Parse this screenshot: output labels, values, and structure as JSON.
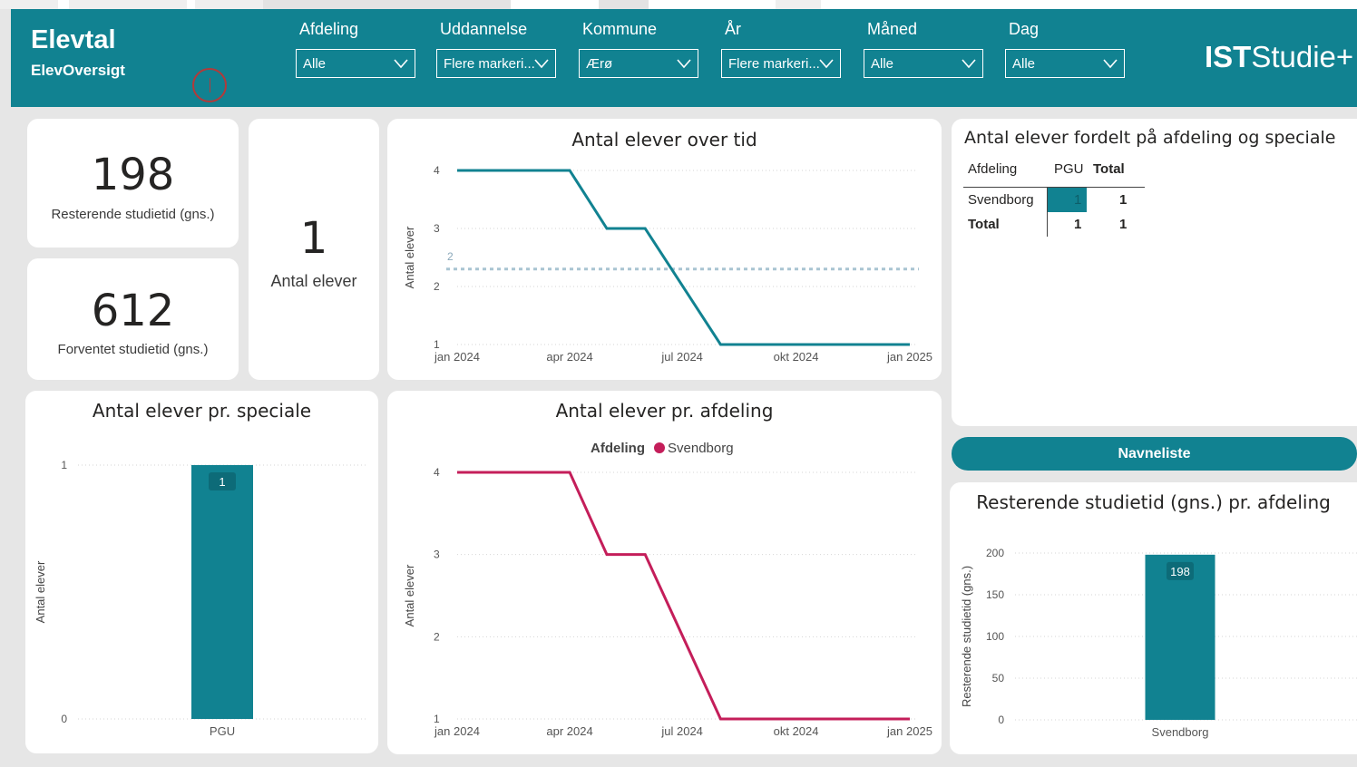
{
  "header": {
    "title": "Elevtal",
    "subtitle": "ElevOversigt",
    "logo_bold": "IST",
    "logo_light": "Studie+"
  },
  "slicers": [
    {
      "label": "Afdeling",
      "value": "Alle"
    },
    {
      "label": "Uddannelse",
      "value": "Flere markeri..."
    },
    {
      "label": "Kommune",
      "value": "Ærø"
    },
    {
      "label": "År",
      "value": "Flere markeri..."
    },
    {
      "label": "Måned",
      "value": "Alle"
    },
    {
      "label": "Dag",
      "value": "Alle"
    }
  ],
  "kpis": {
    "remaining": {
      "value": "198",
      "label": "Resterende studietid (gns.)"
    },
    "expected": {
      "value": "612",
      "label": "Forventet studietid (gns.)"
    },
    "count": {
      "value": "1",
      "label": "Antal elever"
    }
  },
  "matrix": {
    "title": "Antal elever fordelt på afdeling og speciale",
    "col_headers": [
      "Afdeling",
      "PGU",
      "Total"
    ],
    "rows": [
      {
        "label": "Svendborg",
        "pgu": "1",
        "total": "1"
      },
      {
        "label": "Total",
        "pgu": "1",
        "total": "1"
      }
    ]
  },
  "button": {
    "label": "Navneliste"
  },
  "colors": {
    "teal": "#118291",
    "crimson": "#c41e5a",
    "avg_line": "#a9c4d2"
  },
  "chart_data": [
    {
      "id": "over_time",
      "type": "line",
      "title": "Antal elever over tid",
      "xlabel": "",
      "ylabel": "Antal elever",
      "x_ticks": [
        "jan 2024",
        "apr 2024",
        "jul 2024",
        "okt 2024",
        "jan 2025"
      ],
      "x": [
        "2024-01-01",
        "2024-04-01",
        "2024-05-01",
        "2024-06-01",
        "2024-08-01",
        "2025-01-01"
      ],
      "y_ticks": [
        1,
        2,
        3,
        4
      ],
      "ylim": [
        1,
        4
      ],
      "series": [
        {
          "values": [
            4,
            4,
            3,
            3,
            1,
            1
          ],
          "color": "#118291"
        }
      ],
      "average_line": {
        "value": 2.3,
        "label": "2"
      }
    },
    {
      "id": "by_speciale",
      "type": "bar",
      "title": "Antal elever pr. speciale",
      "xlabel": "",
      "ylabel": "Antal elever",
      "categories": [
        "PGU"
      ],
      "values": [
        1
      ],
      "data_labels": [
        "1"
      ],
      "y_ticks": [
        0,
        1
      ],
      "ylim": [
        0,
        1
      ]
    },
    {
      "id": "by_afdeling",
      "type": "line",
      "title": "Antal elever pr. afdeling",
      "legend_title": "Afdeling",
      "legend_position": "top",
      "xlabel": "",
      "ylabel": "Antal elever",
      "x_ticks": [
        "jan 2024",
        "apr 2024",
        "jul 2024",
        "okt 2024",
        "jan 2025"
      ],
      "x": [
        "2024-01-01",
        "2024-04-01",
        "2024-05-01",
        "2024-06-01",
        "2024-08-01",
        "2025-01-01"
      ],
      "y_ticks": [
        1,
        2,
        3,
        4
      ],
      "ylim": [
        1,
        4
      ],
      "series": [
        {
          "name": "Svendborg",
          "values": [
            4,
            4,
            3,
            3,
            1,
            1
          ],
          "color": "#c41e5a"
        }
      ]
    },
    {
      "id": "remaining_by_afdeling",
      "type": "bar",
      "title": "Resterende studietid (gns.) pr. afdeling",
      "xlabel": "",
      "ylabel": "Resterende studietid (gns.)",
      "categories": [
        "Svendborg"
      ],
      "values": [
        198
      ],
      "data_labels": [
        "198"
      ],
      "y_ticks": [
        0,
        50,
        100,
        150,
        200
      ],
      "ylim": [
        0,
        200
      ]
    }
  ]
}
